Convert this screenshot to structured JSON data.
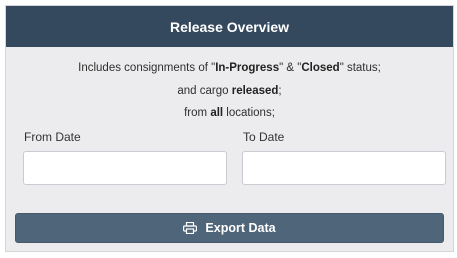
{
  "header": {
    "title": "Release Overview"
  },
  "description": {
    "line1_prefix": "Includes consignments of \"",
    "line1_status1": "In-Progress",
    "line1_mid": "\" & \"",
    "line1_status2": "Closed",
    "line1_suffix": "\" status;",
    "line2_prefix": "and cargo ",
    "line2_bold": "released",
    "line2_suffix": ";",
    "line3_prefix": "from ",
    "line3_bold": "all",
    "line3_suffix": " locations;"
  },
  "form": {
    "from_label": "From Date",
    "from_value": "",
    "to_label": "To Date",
    "to_value": ""
  },
  "export_button": {
    "label": "Export Data",
    "icon": "printer-icon"
  },
  "colors": {
    "header_bg": "#35495e",
    "panel_bg": "#ececee",
    "button_bg": "#4f6579"
  }
}
